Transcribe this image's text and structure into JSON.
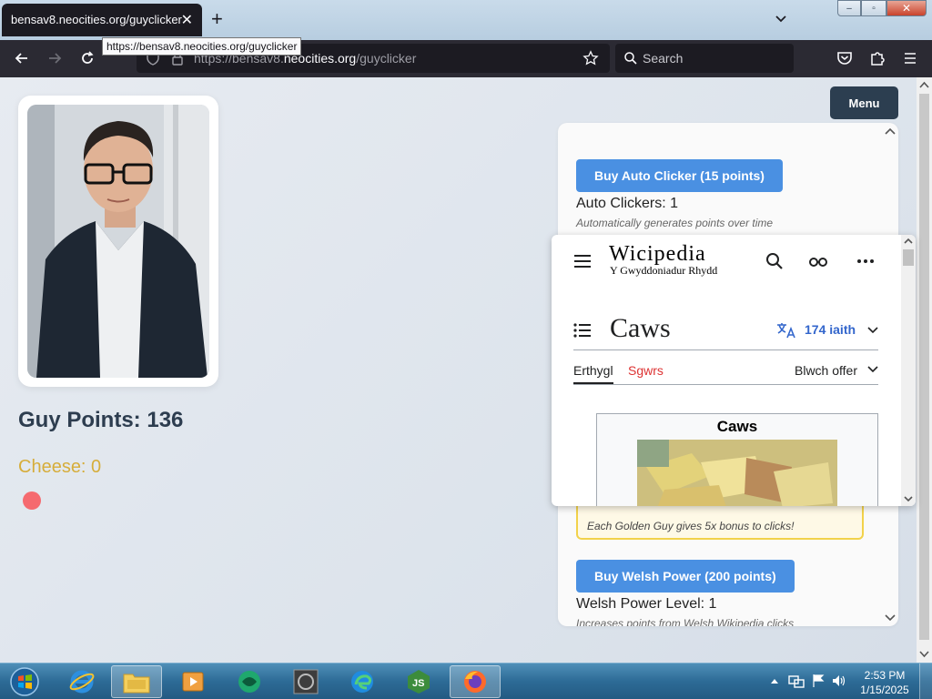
{
  "browser": {
    "tab_title": "bensav8.neocities.org/guyclicker",
    "tab_close": "✕",
    "new_tab": "+",
    "url_prefix": "https://bensav8.",
    "url_domain": "neocities.org",
    "url_path": "/guyclicker",
    "tooltip": "https://bensav8.neocities.org/guyclicker",
    "search_placeholder": "Search",
    "window_controls": {
      "minimize": "–",
      "maximize": "▫",
      "close": "✕"
    }
  },
  "game": {
    "points_label": "Guy Points: 136",
    "cheese_label": "Cheese: 0",
    "menu_label": "Menu",
    "shop": [
      {
        "button": "Buy Auto Clicker (15 points)",
        "count": "Auto Clickers: 1",
        "desc": "Automatically generates points over time"
      },
      {
        "button": "Buy Welsh Power (200 points)",
        "count": "Welsh Power Level: 1",
        "desc": "Increases points from Welsh Wikipedia clicks"
      }
    ],
    "golden_desc": "Each Golden Guy gives 5x bonus to clicks!"
  },
  "wiki": {
    "logo": "Wicipedia",
    "subtitle": "Y Gwyddoniadur Rhydd",
    "title": "Caws",
    "languages": "174 iaith",
    "tab_article": "Erthygl",
    "tab_talk": "Sgwrs",
    "tools": "Blwch offer",
    "infobox_title": "Caws"
  },
  "taskbar": {
    "time": "2:53 PM",
    "date": "1/15/2025",
    "apps": [
      "start-orb",
      "internet-explorer",
      "file-explorer",
      "media-player",
      "browser-green",
      "wolfenstein",
      "edge",
      "nodejs",
      "firefox"
    ]
  },
  "colors": {
    "accent_blue": "#4a90e2",
    "menu_dark": "#2c3e50",
    "cheese_gold": "#d6ad3a",
    "points_text": "#2d3d4f",
    "wiki_link": "#3366cc",
    "wiki_red_link": "#d33"
  }
}
